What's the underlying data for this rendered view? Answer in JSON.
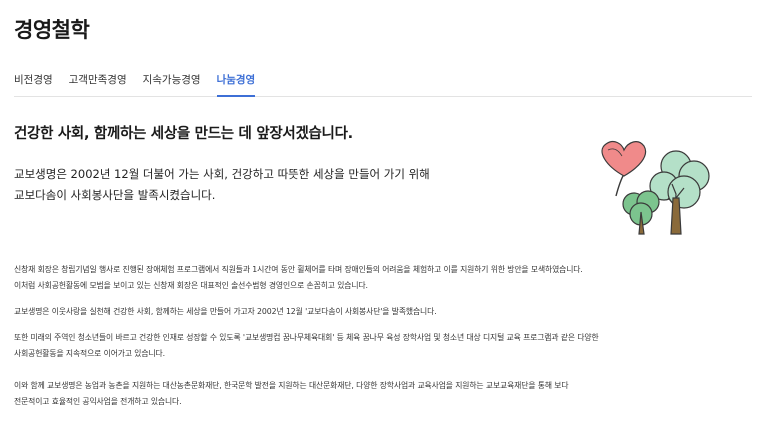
{
  "page": {
    "title": "경영철학"
  },
  "tabs": [
    {
      "label": "비전경영",
      "active": false
    },
    {
      "label": "고객만족경영",
      "active": false
    },
    {
      "label": "지속가능경영",
      "active": false
    },
    {
      "label": "나눔경영",
      "active": true
    }
  ],
  "headline": "건강한 사회, 함께하는 세상을 만드는 데 앞장서겠습니다.",
  "intro": {
    "line1": "교보생명은 2002년 12월 더불어 가는 사회, 건강하고 따뜻한 세상을 만들어 가기 위해",
    "line2": "교보다솜이 사회봉사단을 발족시켰습니다."
  },
  "paragraphs": {
    "p1": {
      "line1": "신창재 회장은 창립기념일 행사로 진행된 장애체험 프로그램에서 직원들과 1시간여 동안 휠체어를 타며 장애인들의 어려움을 체험하고 이를 지원하기 위한 방안을 모색하였습니다.",
      "line2": "이처럼 사회공헌활동에 모범을 보이고 있는 신창재 회장은 대표적인 솔선수범형 경영인으로 손꼽히고 있습니다."
    },
    "p2": {
      "line1": "교보생명은 이웃사랑을 실천해 건강한 사회, 함께하는 세상을 만들어 가고자 2002년 12월 '교보다솜이 사회봉사단'을 발족했습니다."
    },
    "p3": {
      "line1": "또한 미래의 주역인 청소년들이 바르고 건강한 인재로 성장할 수 있도록 '교보생명컵 꿈나무체육대회' 등 체육 꿈나무 육성 장학사업 및 청소년 대상 디지털 교육 프로그램과 같은 다양한",
      "line2": "사회공헌활동을 지속적으로 이어가고 있습니다."
    },
    "p4": {
      "line1": "이와 함께 교보생명은 농업과 농촌을 지원하는 대산농촌문화재단, 한국문학 발전을 지원하는 대산문화재단, 다양한 장학사업과 교육사업을 지원하는 교보교육재단을 통해 보다",
      "line2": "전문적이고 효율적인 공익사업을 전개하고 있습니다."
    }
  },
  "illustration": {
    "icon": "heart-tree-icon",
    "colors": {
      "heart": "#f08a8a",
      "heart_outline": "#3a3a3a",
      "tree_light": "#b4e0c8",
      "tree_mid": "#7cc48e",
      "trunk": "#8a6a3a"
    }
  }
}
